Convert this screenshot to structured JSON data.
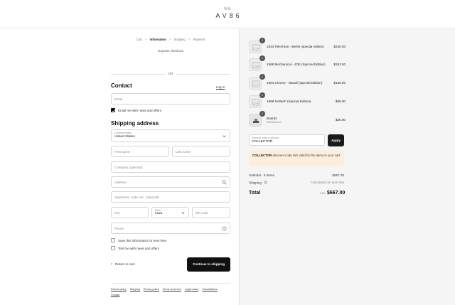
{
  "brand": {
    "mark": "%%",
    "name": "AV86"
  },
  "breadcrumb": [
    {
      "label": "Cart",
      "current": false
    },
    {
      "label": "Information",
      "current": true
    },
    {
      "label": "Shipping",
      "current": false
    },
    {
      "label": "Payment",
      "current": false
    }
  ],
  "breadcrumb_separator": ">",
  "express_checkout": "Express checkout",
  "or_divider": "OR",
  "contact": {
    "heading": "Contact",
    "login_link": "Log in",
    "email_placeholder": "Email",
    "newsletter_label": "Email me with news and offers",
    "newsletter_checked": true
  },
  "shipping": {
    "heading": "Shipping address",
    "country_label": "Country/Region",
    "country_value": "United States",
    "first_name_placeholder": "First name",
    "last_name_placeholder": "Last name",
    "company_placeholder": "Company (optional)",
    "address_placeholder": "Address",
    "apartment_placeholder": "Apartment, suite, etc. (optional)",
    "city_placeholder": "City",
    "state_label": "State",
    "state_value": "Iowa",
    "zip_placeholder": "ZIP code",
    "phone_placeholder": "Phone",
    "save_info_label": "Save this information for next time",
    "save_info_checked": false,
    "text_me_label": "Text me with news and offers",
    "text_me_checked": false
  },
  "actions": {
    "return_label": "Return to cart",
    "continue_label": "Continue to shipping"
  },
  "footer_links": [
    "Refund policy",
    "Shipping",
    "Privacy policy",
    "Terms of service",
    "Legal notice",
    "Cancellations",
    "Contact"
  ],
  "order": {
    "items": [
      {
        "quantity": "1",
        "name": "1934 Telechron - Berlin (special edition)",
        "subtitle": "",
        "price": "$240.00"
      },
      {
        "quantity": "1",
        "name": "1968 Mechanical - JOE (Special Edition)",
        "subtitle": "",
        "price": "$153.00"
      },
      {
        "quantity": "1",
        "name": "1904 Chrono - Nawaf (Special Edition)",
        "subtitle": "",
        "price": "$159.00"
      },
      {
        "quantity": "1",
        "name": "1968 NAWAF (Special Edition)",
        "subtitle": "",
        "price": "$69.00"
      },
      {
        "quantity": "1",
        "name": "Boards",
        "subtitle": "500x500mm",
        "price": "$26.00"
      }
    ],
    "discount_label": "Discount code or gift card",
    "discount_value": "COLLECTOR",
    "apply_label": "Apply",
    "notice_code": "COLLECTOR",
    "notice_text": "discount code isn't valid for the items in your cart",
    "subtotal_label": "Subtotal · 5 items",
    "subtotal_value": "$667.00",
    "shipping_label": "Shipping",
    "shipping_value": "Calculated at next step",
    "total_label": "Total",
    "currency": "USD",
    "total_value": "$667.00"
  },
  "colors": {
    "button": "#111111",
    "notice_bg": "#fbeedd",
    "summary_bg": "#f5f5f5"
  }
}
